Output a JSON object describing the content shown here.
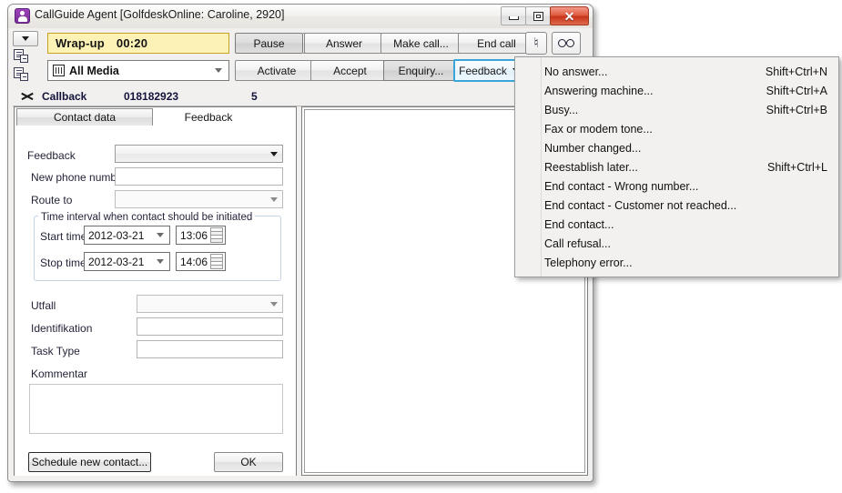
{
  "window": {
    "title": "CallGuide Agent [GolfdeskOnline: Caroline, 2920]",
    "app_icon": "person-icon",
    "minimize_label": "Minimize",
    "maximize_label": "Maximize",
    "close_label": "✕"
  },
  "toolbar": {
    "rail_dropdown": "toolbar-options-caret",
    "rail_icon_1": "contact-list-icon",
    "rail_icon_2": "task-list-icon",
    "status_label": "Wrap-up",
    "status_timer": "00:20",
    "media_filter": "All Media",
    "media_icon": "media-filter-icon",
    "buttons": {
      "pause": "Pause",
      "answer": "Answer",
      "make_call": "Make call...",
      "end_call": "End call",
      "activate": "Activate",
      "accept": "Accept",
      "enquiry": "Enquiry...",
      "feedback": "Feedback"
    },
    "music_icon": "music-note-icon",
    "voicemail_icon": "voicemail-icon"
  },
  "callback_row": {
    "icon": "callback-scissors-icon",
    "type": "Callback",
    "number": "018182923",
    "count": "5"
  },
  "tabs": [
    {
      "label": "Contact data",
      "active": false
    },
    {
      "label": "Feedback",
      "active": true
    }
  ],
  "form": {
    "feedback_label": "Feedback",
    "feedback_value": "",
    "new_phone_label": "New phone number",
    "new_phone_value": "",
    "route_to_label": "Route to",
    "route_to_value": "",
    "group_title": "Time interval when contact should be initiated",
    "start_time_label": "Start time",
    "start_date": "2012-03-21",
    "start_time": "13:06",
    "stop_time_label": "Stop time",
    "stop_date": "2012-03-21",
    "stop_time": "14:06",
    "utfall_label": "Utfall",
    "utfall_value": "",
    "identifikation_label": "Identifikation",
    "identifikation_value": "",
    "task_type_label": "Task Type",
    "task_type_value": "",
    "kommentar_label": "Kommentar",
    "kommentar_value": "",
    "schedule_button": "Schedule new contact...",
    "ok_button": "OK"
  },
  "context_menu": {
    "items": [
      {
        "label": "No answer...",
        "shortcut": "Shift+Ctrl+N"
      },
      {
        "label": "Answering machine...",
        "shortcut": "Shift+Ctrl+A"
      },
      {
        "label": "Busy...",
        "shortcut": "Shift+Ctrl+B"
      },
      {
        "label": "Fax or modem tone...",
        "shortcut": ""
      },
      {
        "label": "Number changed...",
        "shortcut": ""
      },
      {
        "label": "Reestablish later...",
        "shortcut": "Shift+Ctrl+L"
      },
      {
        "label": "End contact - Wrong number...",
        "shortcut": ""
      },
      {
        "label": "End contact - Customer not reached...",
        "shortcut": ""
      },
      {
        "label": "End contact...",
        "shortcut": ""
      },
      {
        "label": "Call refusal...",
        "shortcut": ""
      },
      {
        "label": "Telephony error...",
        "shortcut": ""
      }
    ]
  },
  "colors": {
    "status_bg": "#fdf2b6",
    "status_border": "#c9a227",
    "focus_border": "#3aa6d8",
    "close_button": "#c8341a",
    "app_icon": "#7a2f99"
  }
}
